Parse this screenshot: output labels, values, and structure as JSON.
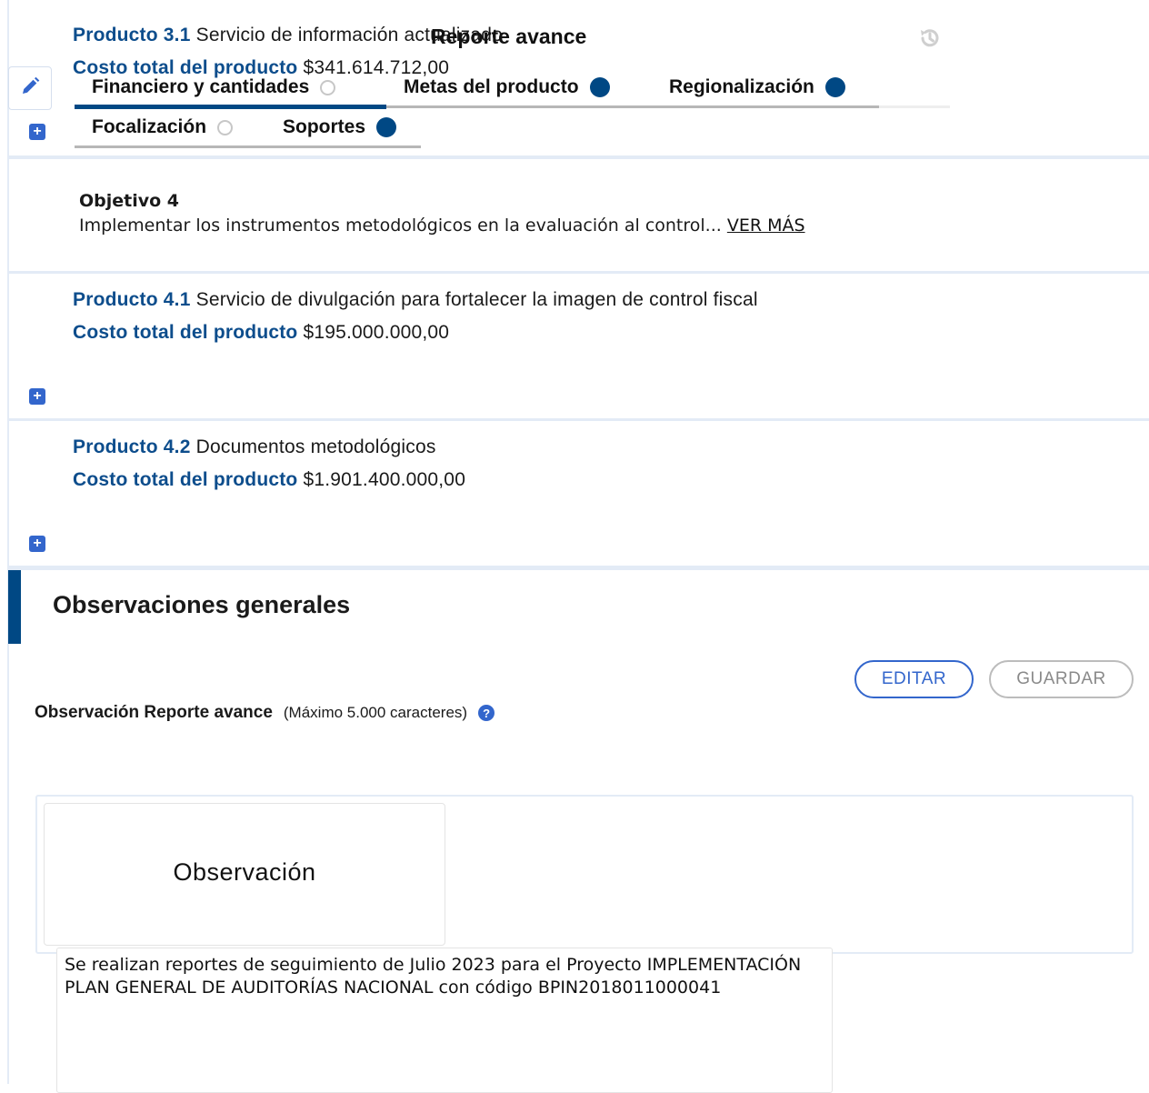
{
  "overlay_title": "Reporte avance",
  "product_31": {
    "code": "Producto 3.1",
    "name": "Servicio de información actualizado",
    "cost_label": "Costo total del producto",
    "cost_value": "$341.614.712,00"
  },
  "tabs": [
    {
      "label": "Financiero y cantidades",
      "status": "empty",
      "active": true
    },
    {
      "label": "Metas del producto",
      "status": "complete"
    },
    {
      "label": "Regionalización",
      "status": "complete"
    },
    {
      "label": "Focalización",
      "status": "empty"
    },
    {
      "label": "Soportes",
      "status": "complete"
    }
  ],
  "objective_4": {
    "label": "Objetivo 4",
    "text": "Implementar los instrumentos metodológicos en la evaluación al control...",
    "more_link": "VER MÁS"
  },
  "product_41": {
    "code": "Producto 4.1",
    "name": "Servicio de divulgación para fortalecer la imagen de control fiscal",
    "cost_label": "Costo total del producto",
    "cost_value": "$195.000.000,00"
  },
  "product_42": {
    "code": "Producto 4.2",
    "name": "Documentos metodológicos",
    "cost_label": "Costo total del producto",
    "cost_value": "$1.901.400.000,00"
  },
  "general_observations": {
    "section_title": "Observaciones generales",
    "edit_label": "EDITAR",
    "save_label": "GUARDAR",
    "field_label": "Observación Reporte avance",
    "field_hint": "(Máximo 5.000 caracteres)",
    "card_title": "Observación",
    "text_value": "Se realizan reportes de seguimiento de Julio 2023 para el Proyecto IMPLEMENTACIÓN PLAN GENERAL DE AUDITORÍAS NACIONAL con código BPIN2018011000041"
  },
  "colors": {
    "primary": "#004884",
    "accent": "#3366cc",
    "label_blue": "#0d4d8c"
  },
  "icons": {
    "history": "history-icon",
    "edit": "pencil-icon",
    "expand": "plus-icon",
    "help": "question-circle-icon"
  }
}
